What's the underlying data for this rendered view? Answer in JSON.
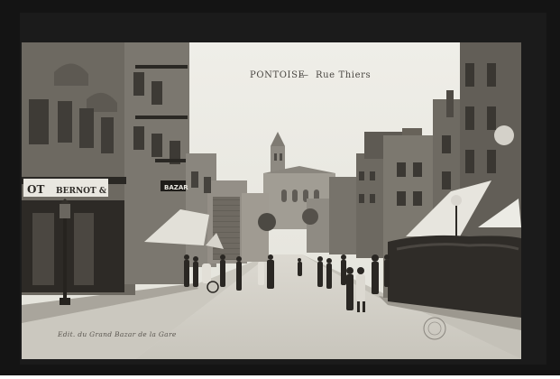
{
  "postcard": {
    "town": "PONTOISE",
    "separator": "—",
    "street": "Rue Thiers",
    "publisher": "Edit. du Grand Bazar de la Gare"
  },
  "storefront": {
    "sign_left": "OT",
    "sign_right": "BERNOT &",
    "bazar_sign": "BAZAR"
  },
  "colors": {
    "sky": "#ebeae2",
    "paper": "#f1efe9",
    "frame": "#161616",
    "building_dark": "#3d3a36",
    "building_mid": "#7d7870",
    "road": "#cfccc3"
  }
}
